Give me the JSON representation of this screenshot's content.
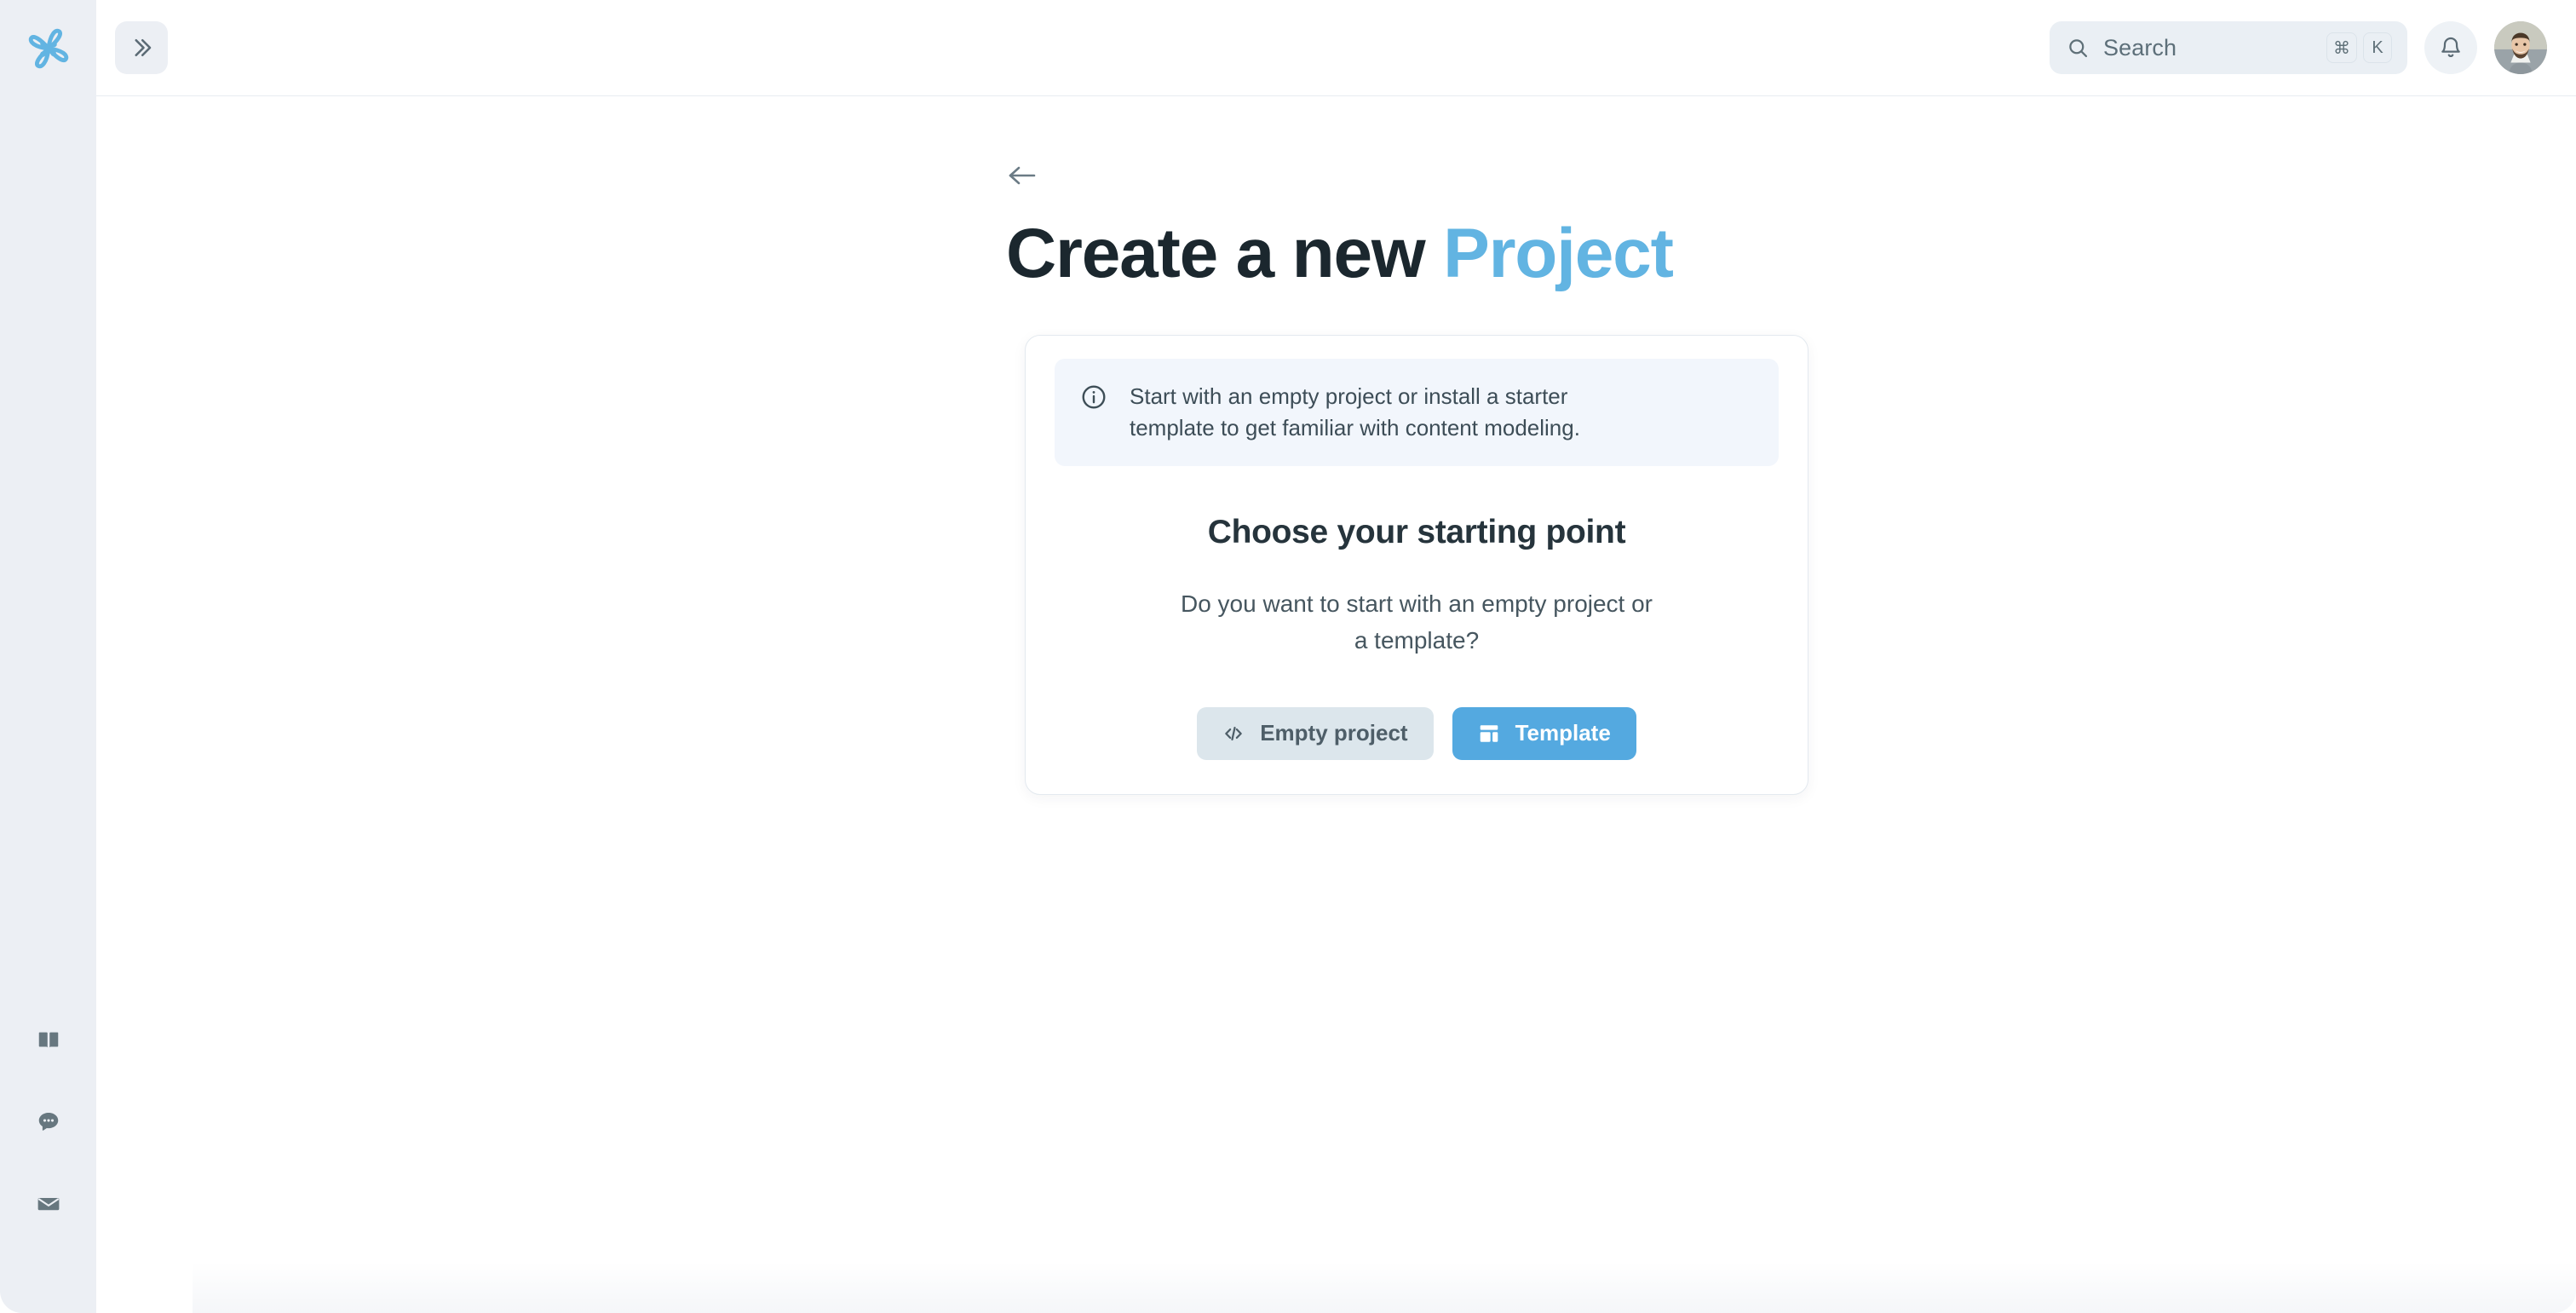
{
  "brand": {
    "logo_icon": "atom-logo-icon",
    "accent_color": "#62b4e2",
    "rail_bg": "#eceff4"
  },
  "sidebar": {
    "collapse_button": {
      "icon": "chevrons-right-icon",
      "label": ""
    },
    "bottom_items": [
      {
        "icon": "book-icon",
        "name": "documentation"
      },
      {
        "icon": "chat-bubble-icon",
        "name": "support-chat"
      },
      {
        "icon": "envelope-icon",
        "name": "contact-mail"
      }
    ]
  },
  "header": {
    "search": {
      "placeholder": "Search",
      "icon": "search-icon",
      "shortcut": [
        "⌘",
        "K"
      ]
    },
    "notifications": {
      "icon": "bell-icon"
    },
    "avatar": {
      "name": "user-avatar"
    }
  },
  "page": {
    "back_icon": "arrow-left-icon",
    "title_primary": "Create a new ",
    "title_accent": "Project"
  },
  "card": {
    "notice": {
      "icon": "info-circle-icon",
      "text": "Start with an empty project or install a starter template to get familiar with content modeling."
    },
    "heading": "Choose your starting point",
    "subtext": "Do you want to start with an empty project or a template?",
    "buttons": [
      {
        "label": "Empty project",
        "icon": "code-brackets-icon",
        "style": "secondary"
      },
      {
        "label": "Template",
        "icon": "layout-dashboard-icon",
        "style": "primary"
      }
    ]
  }
}
